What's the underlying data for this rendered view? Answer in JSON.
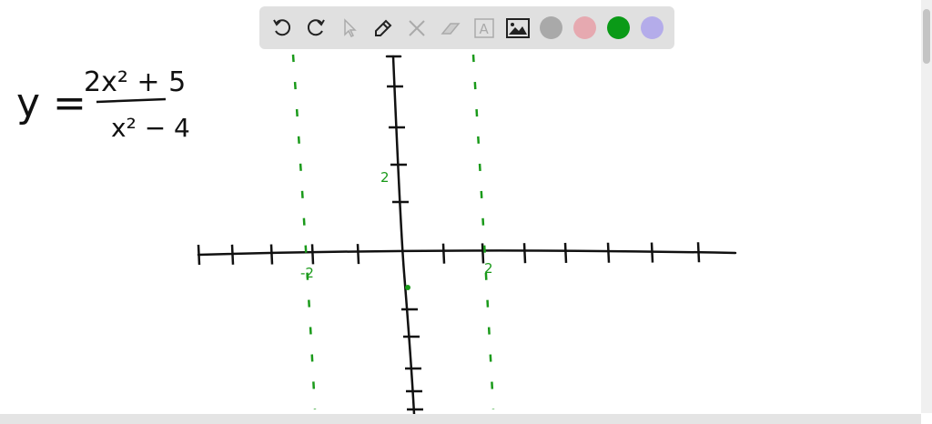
{
  "toolbar": {
    "tools": [
      "undo-icon",
      "redo-icon",
      "select-icon",
      "pen-icon",
      "tools-icon",
      "eraser-icon",
      "text-icon",
      "image-icon"
    ],
    "colors": [
      "#a9a9a9",
      "#e6a9b0",
      "#0a9a17",
      "#b4acea"
    ],
    "text_tool_glyph": "A"
  },
  "board": {
    "equation": {
      "lhs": "y =",
      "numerator": "2x² + 5",
      "denominator": "x² − 4"
    },
    "labels": {
      "neg_asymptote": "-2",
      "pos_asymptote": "2",
      "y_tick": "2"
    },
    "ink_color": "#111111",
    "asymptote_color": "#1a9a1a"
  }
}
